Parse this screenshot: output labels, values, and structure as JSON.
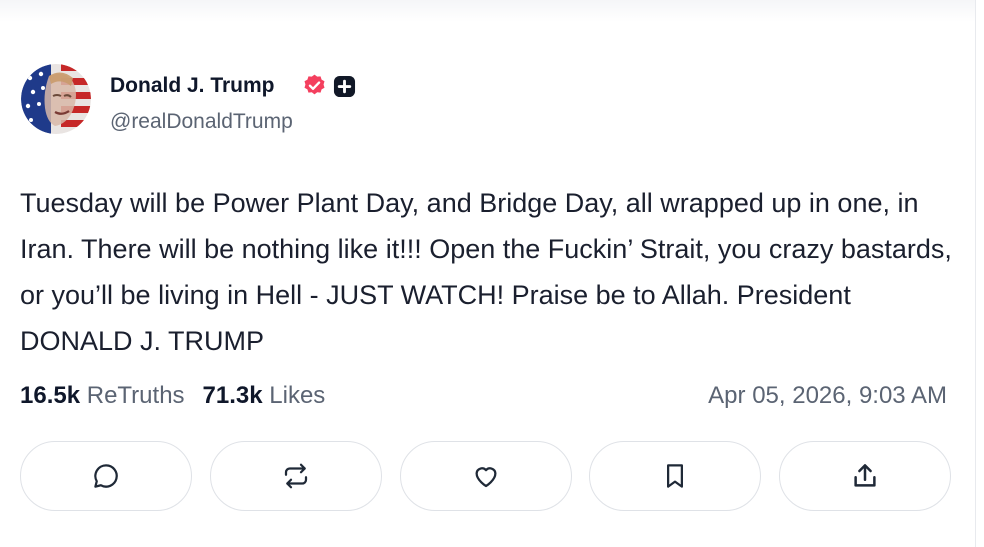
{
  "post": {
    "author": {
      "display_name": "Donald J. Trump",
      "handle": "@realDonaldTrump",
      "avatar_icon": "flag-portrait-avatar",
      "verified_icon": "verified-badge-icon",
      "verified_color": "#f43f5e",
      "extra_badge_icon": "plus-badge-icon"
    },
    "text": "Tuesday will be Power Plant Day, and Bridge Day, all wrapped up in one, in Iran. There will be nothing like it!!! Open the Fuckin’ Strait, you crazy bastards, or you’ll be living in Hell - JUST WATCH! Praise be to Allah. President DONALD J. TRUMP",
    "stats": {
      "retruths_count": "16.5k",
      "retruths_label": "ReTruths",
      "likes_count": "71.3k",
      "likes_label": "Likes"
    },
    "timestamp": "Apr 05, 2026, 9:03 AM",
    "actions": [
      {
        "name": "reply",
        "icon": "comment-icon"
      },
      {
        "name": "retruth",
        "icon": "repost-icon"
      },
      {
        "name": "like",
        "icon": "heart-icon"
      },
      {
        "name": "bookmark",
        "icon": "bookmark-icon"
      },
      {
        "name": "share",
        "icon": "share-upload-icon"
      }
    ]
  },
  "colors": {
    "text_primary": "#0f172a",
    "text_secondary": "#5b6473",
    "border": "#dfe2e7"
  }
}
